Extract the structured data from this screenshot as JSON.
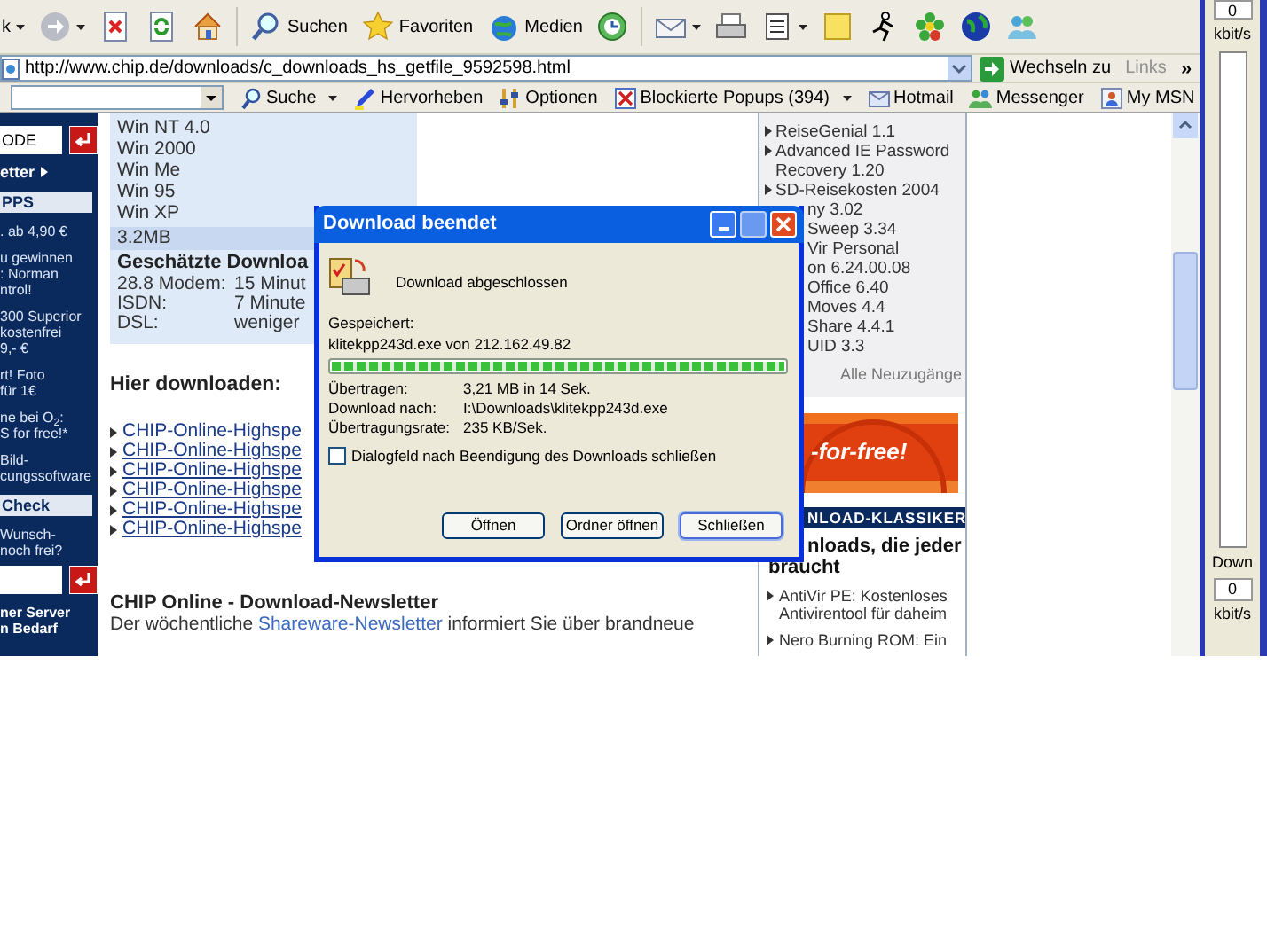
{
  "toolbar": {
    "buttons": [
      {
        "kind": "back",
        "label": "k"
      },
      {
        "kind": "forward"
      },
      {
        "kind": "stop"
      },
      {
        "kind": "refresh"
      },
      {
        "kind": "home"
      },
      {
        "kind": "search",
        "label": "Suchen"
      },
      {
        "kind": "favorites",
        "label": "Favoriten"
      },
      {
        "kind": "media",
        "label": "Medien"
      },
      {
        "kind": "history"
      },
      {
        "kind": "mail"
      },
      {
        "kind": "print"
      },
      {
        "kind": "edit"
      },
      {
        "kind": "note"
      },
      {
        "kind": "aim"
      },
      {
        "kind": "icq"
      },
      {
        "kind": "globe"
      },
      {
        "kind": "msn"
      }
    ]
  },
  "address_bar": {
    "url": "http://www.chip.de/downloads/c_downloads_hs_getfile_9592598.html",
    "go_label": "Wechseln zu",
    "links_label": "Links",
    "more": "»"
  },
  "links_bar": {
    "items": [
      {
        "kind": "search",
        "label": "Suche"
      },
      {
        "kind": "highlight",
        "label": "Hervorheben"
      },
      {
        "kind": "options",
        "label": "Optionen"
      },
      {
        "kind": "popups",
        "label": "Blockierte Popups (394)"
      },
      {
        "kind": "hotmail",
        "label": "Hotmail"
      },
      {
        "kind": "messenger",
        "label": "Messenger"
      },
      {
        "kind": "mymsn",
        "label": "My MSN"
      }
    ]
  },
  "sidebar": {
    "items": [
      {
        "kind": "input",
        "value": "ODE"
      },
      {
        "kind": "arrow",
        "lines": [
          "etter"
        ]
      },
      {
        "kind": "header",
        "lines": [
          "PPS"
        ]
      },
      {
        "kind": "text",
        "lines": [
          ". ab 4,90 €"
        ]
      },
      {
        "kind": "text",
        "lines": [
          "u gewinnen",
          ": Norman",
          "ntrol!"
        ]
      },
      {
        "kind": "text",
        "lines": [
          "300 Superior",
          "kostenfrei",
          "9,- €"
        ]
      },
      {
        "kind": "text",
        "lines": [
          "rt! Foto",
          "für 1€"
        ]
      },
      {
        "kind": "text",
        "lines": [
          "ne bei O$_{2}$:",
          "S for free!*"
        ]
      },
      {
        "kind": "text",
        "lines": [
          "Bild-",
          "cungssoftware"
        ]
      },
      {
        "kind": "header",
        "lines": [
          "Check"
        ]
      },
      {
        "kind": "text",
        "lines": [
          "Wunsch-",
          "noch frei?"
        ]
      },
      {
        "kind": "input"
      },
      {
        "kind": "bold",
        "lines": [
          "ner Server",
          "n Bedarf"
        ]
      }
    ]
  },
  "content": {
    "systems": [
      "Win NT 4.0",
      "Win 2000",
      "Win Me",
      "Win 95",
      "Win XP"
    ],
    "size": "3.2MB",
    "estimate": {
      "title": "Geschätzte Downloa",
      "rows": [
        {
          "label": "28.8 Modem:",
          "value": "15 Minut"
        },
        {
          "label": "ISDN:",
          "value": "7 Minute"
        },
        {
          "label": "DSL:",
          "value": "weniger"
        }
      ]
    },
    "download_heading": "Hier downloaden:",
    "download_links": [
      {
        "text": "CHIP-Online-Highspe",
        "underlined": false
      },
      {
        "text": "CHIP-Online-Highspe",
        "underlined": true
      },
      {
        "text": "CHIP-Online-Highspe",
        "underlined": true
      },
      {
        "text": "CHIP-Online-Highspe",
        "underlined": true
      },
      {
        "text": "CHIP-Online-Highspe",
        "underlined": true
      },
      {
        "text": "CHIP-Online-Highspe",
        "underlined": true
      }
    ],
    "newsletter": {
      "title": "CHIP Online - Download-Newsletter",
      "text_before": "Der wöchentliche ",
      "link": "Shareware-Newsletter",
      "text_after": " informiert Sie über brandneue"
    }
  },
  "right_column": {
    "new_items": [
      {
        "kind": "full",
        "text": "ReiseGenial 1.1"
      },
      {
        "kind": "full",
        "text": "Advanced IE Password Recovery 1.20"
      },
      {
        "kind": "full",
        "text": "SD-Reisekosten 2004"
      },
      {
        "kind": "clipped",
        "text": "ny 3.02"
      },
      {
        "kind": "clipped",
        "text": "Sweep 3.34"
      },
      {
        "kind": "clipped",
        "text": "Vir Personal"
      },
      {
        "kind": "clipped",
        "text": "on 6.24.00.08"
      },
      {
        "kind": "clipped",
        "text": "Office 6.40"
      },
      {
        "kind": "clipped",
        "text": "Moves 4.4"
      },
      {
        "kind": "clipped",
        "text": "Share 4.4.1"
      },
      {
        "kind": "clipped",
        "text": "UID 3.3"
      }
    ],
    "all_link": "Alle Neuzugänge",
    "banner": {
      "text": "-for-free!"
    },
    "classics": {
      "header": "NLOAD-KLASSIKER",
      "title_lines": [
        "nloads, die jeder",
        "braucht"
      ],
      "items": [
        "AntiVir PE: Kostenloses Antivirentool für daheim",
        "Nero Burning ROM: Ein"
      ]
    }
  },
  "meter": {
    "top_value": "0",
    "top_unit": "kbit/s",
    "label": "Down",
    "bottom_value": "0",
    "bottom_unit": "kbit/s"
  },
  "dialog": {
    "title": "Download beendet",
    "status": "Download abgeschlossen",
    "saved_label": "Gespeichert:",
    "saved_text": "klitekpp243d.exe von 212.162.49.82",
    "progress": {
      "level": 1
    },
    "rows": [
      {
        "label": "Übertragen:",
        "value": "3,21 MB in 14 Sek."
      },
      {
        "label": "Download nach:",
        "value": "I:\\Downloads\\klitekpp243d.exe"
      },
      {
        "label": "Übertragungsrate:",
        "value": "235 KB/Sek."
      }
    ],
    "checkbox": {
      "label": "Dialogfeld nach Beendigung des Downloads schließen",
      "checked": false
    },
    "buttons": [
      {
        "label": "Öffnen",
        "default": false
      },
      {
        "label": "Ordner öffnen",
        "default": false
      },
      {
        "label": "Schließen",
        "default": true
      }
    ]
  }
}
